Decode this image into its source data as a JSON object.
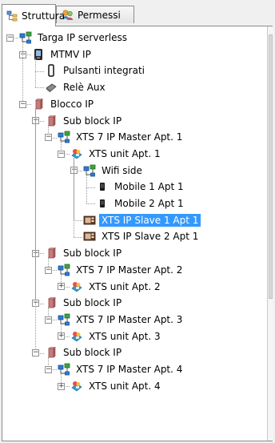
{
  "tabs": [
    {
      "label": "Struttura",
      "icon": "tree-structure-icon",
      "active": true
    },
    {
      "label": "Permessi",
      "icon": "permissions-icon",
      "active": false
    }
  ],
  "tree": [
    {
      "label": "Targa IP serverless",
      "icon": "network-icon",
      "level": 0,
      "expander": "minus"
    },
    {
      "label": "MTMV IP",
      "icon": "monitor-icon",
      "level": 1,
      "expander": "minus"
    },
    {
      "label": "Pulsanti integrati",
      "icon": "pushbutton-icon",
      "level": 2,
      "expander": null
    },
    {
      "label": "Relè Aux",
      "icon": "relay-icon",
      "level": 2,
      "expander": null
    },
    {
      "label": "Blocco IP",
      "icon": "block-icon",
      "level": 1,
      "expander": "minus"
    },
    {
      "label": "Sub block IP",
      "icon": "block-icon",
      "level": 2,
      "expander": "minus"
    },
    {
      "label": "XTS 7 IP Master Apt. 1",
      "icon": "network-icon",
      "level": 3,
      "expander": "minus"
    },
    {
      "label": "XTS unit Apt. 1",
      "icon": "unit-icon",
      "level": 4,
      "expander": "minus"
    },
    {
      "label": "Wifi side",
      "icon": "network-icon",
      "level": 5,
      "expander": "minus"
    },
    {
      "label": "Mobile 1 Apt 1",
      "icon": "mobile-icon",
      "level": 6,
      "expander": null
    },
    {
      "label": "Mobile 2 Apt 1",
      "icon": "mobile-icon",
      "level": 6,
      "expander": null
    },
    {
      "label": "XTS IP Slave 1 Apt 1",
      "icon": "slave-device-icon",
      "level": 5,
      "expander": null,
      "selected": true
    },
    {
      "label": "XTS IP Slave 2 Apt 1",
      "icon": "slave-device-icon",
      "level": 5,
      "expander": null
    },
    {
      "label": "Sub block IP",
      "icon": "block-icon",
      "level": 2,
      "expander": "minus"
    },
    {
      "label": "XTS 7 IP Master Apt. 2",
      "icon": "network-icon",
      "level": 3,
      "expander": "minus"
    },
    {
      "label": "XTS unit Apt. 2",
      "icon": "unit-icon",
      "level": 4,
      "expander": "plus"
    },
    {
      "label": "Sub block IP",
      "icon": "block-icon",
      "level": 2,
      "expander": "minus"
    },
    {
      "label": "XTS 7 IP Master Apt. 3",
      "icon": "network-icon",
      "level": 3,
      "expander": "minus"
    },
    {
      "label": "XTS unit Apt. 3",
      "icon": "unit-icon",
      "level": 4,
      "expander": "plus"
    },
    {
      "label": "Sub block IP",
      "icon": "block-icon",
      "level": 2,
      "expander": "minus"
    },
    {
      "label": "XTS 7 IP Master Apt. 4",
      "icon": "network-icon",
      "level": 3,
      "expander": "minus"
    },
    {
      "label": "XTS unit Apt. 4",
      "icon": "unit-icon",
      "level": 4,
      "expander": "plus"
    }
  ],
  "colors": {
    "selection": "#3399ff",
    "selection_text": "#ffffff"
  }
}
